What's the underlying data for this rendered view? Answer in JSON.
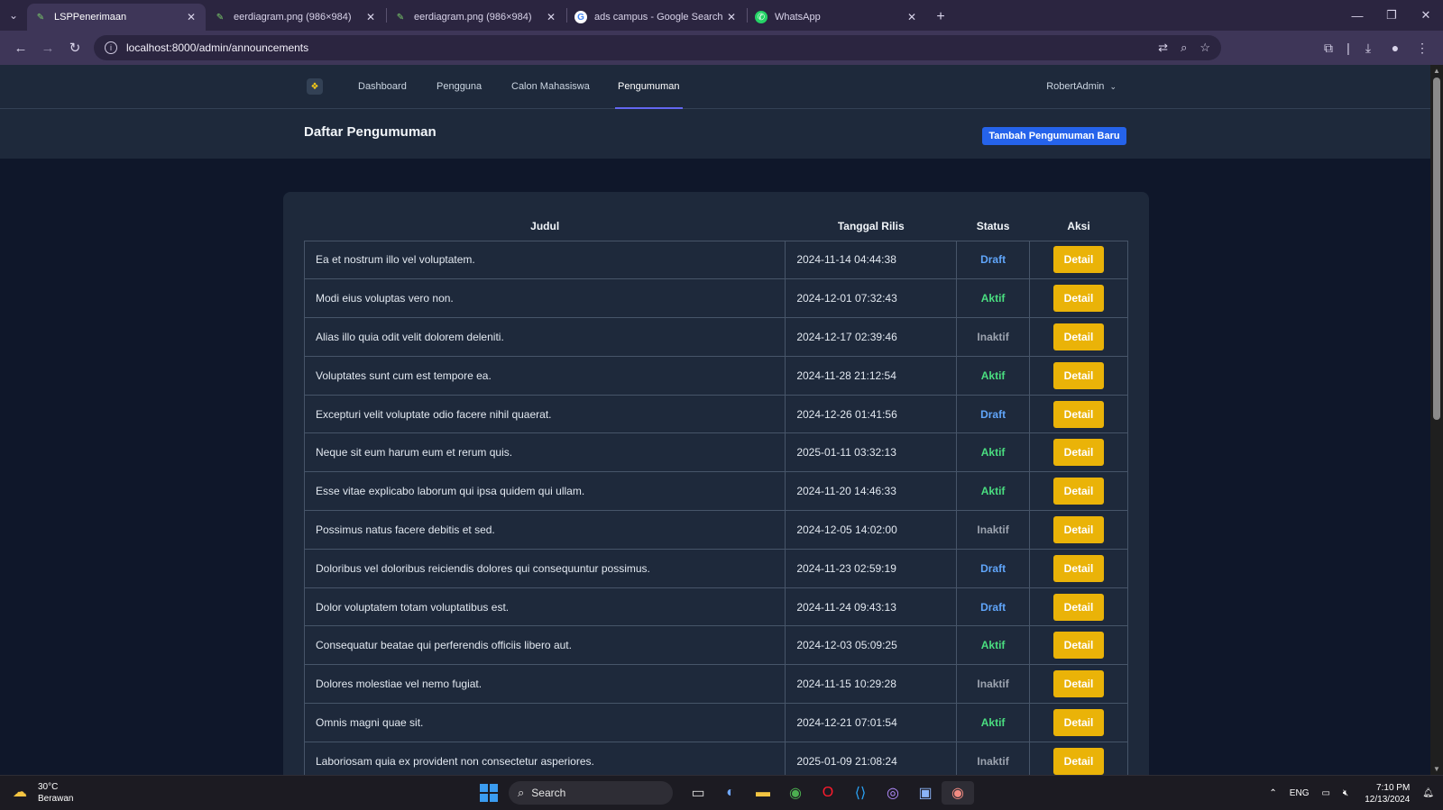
{
  "browser": {
    "tabs": [
      {
        "title": "LSPPenerimaan",
        "icon": "leaf-icon",
        "active": true
      },
      {
        "title": "eerdiagram.png (986×984)",
        "icon": "leaf-icon",
        "active": false
      },
      {
        "title": "eerdiagram.png (986×984)",
        "icon": "leaf-icon",
        "active": false
      },
      {
        "title": "ads campus - Google Search",
        "icon": "google-icon",
        "active": false
      },
      {
        "title": "WhatsApp",
        "icon": "whatsapp-icon",
        "active": false
      }
    ],
    "url": "localhost:8000/admin/announcements"
  },
  "nav": {
    "links": [
      "Dashboard",
      "Pengguna",
      "Calon Mahasiswa",
      "Pengumuman"
    ],
    "active": "Pengumuman",
    "user": "RobertAdmin"
  },
  "header": {
    "title": "Daftar Pengumuman",
    "add_button": "Tambah Pengumuman Baru"
  },
  "table": {
    "columns": [
      "Judul",
      "Tanggal Rilis",
      "Status",
      "Aksi"
    ],
    "action_label": "Detail",
    "rows": [
      {
        "judul": "Ea et nostrum illo vel voluptatem.",
        "tanggal": "2024-11-14 04:44:38",
        "status": "Draft"
      },
      {
        "judul": "Modi eius voluptas vero non.",
        "tanggal": "2024-12-01 07:32:43",
        "status": "Aktif"
      },
      {
        "judul": "Alias illo quia odit velit dolorem deleniti.",
        "tanggal": "2024-12-17 02:39:46",
        "status": "Inaktif"
      },
      {
        "judul": "Voluptates sunt cum est tempore ea.",
        "tanggal": "2024-11-28 21:12:54",
        "status": "Aktif"
      },
      {
        "judul": "Excepturi velit voluptate odio facere nihil quaerat.",
        "tanggal": "2024-12-26 01:41:56",
        "status": "Draft"
      },
      {
        "judul": "Neque sit eum harum eum et rerum quis.",
        "tanggal": "2025-01-11 03:32:13",
        "status": "Aktif"
      },
      {
        "judul": "Esse vitae explicabo laborum qui ipsa quidem qui ullam.",
        "tanggal": "2024-11-20 14:46:33",
        "status": "Aktif"
      },
      {
        "judul": "Possimus natus facere debitis et sed.",
        "tanggal": "2024-12-05 14:02:00",
        "status": "Inaktif"
      },
      {
        "judul": "Doloribus vel doloribus reiciendis dolores qui consequuntur possimus.",
        "tanggal": "2024-11-23 02:59:19",
        "status": "Draft"
      },
      {
        "judul": "Dolor voluptatem totam voluptatibus est.",
        "tanggal": "2024-11-24 09:43:13",
        "status": "Draft"
      },
      {
        "judul": "Consequatur beatae qui perferendis officiis libero aut.",
        "tanggal": "2024-12-03 05:09:25",
        "status": "Aktif"
      },
      {
        "judul": "Dolores molestiae vel nemo fugiat.",
        "tanggal": "2024-11-15 10:29:28",
        "status": "Inaktif"
      },
      {
        "judul": "Omnis magni quae sit.",
        "tanggal": "2024-12-21 07:01:54",
        "status": "Aktif"
      },
      {
        "judul": "Laboriosam quia ex provident non consectetur asperiores.",
        "tanggal": "2025-01-09 21:08:24",
        "status": "Inaktif"
      }
    ]
  },
  "taskbar": {
    "weather_temp": "30°C",
    "weather_desc": "Berawan",
    "search_label": "Search",
    "language": "ENG",
    "time": "7:10 PM",
    "date": "12/13/2024"
  },
  "colors": {
    "accent": "#2563eb",
    "detail_button": "#eab308",
    "status_draft": "#60a5fa",
    "status_aktif": "#4ade80",
    "status_inaktif": "#9ca3af"
  }
}
